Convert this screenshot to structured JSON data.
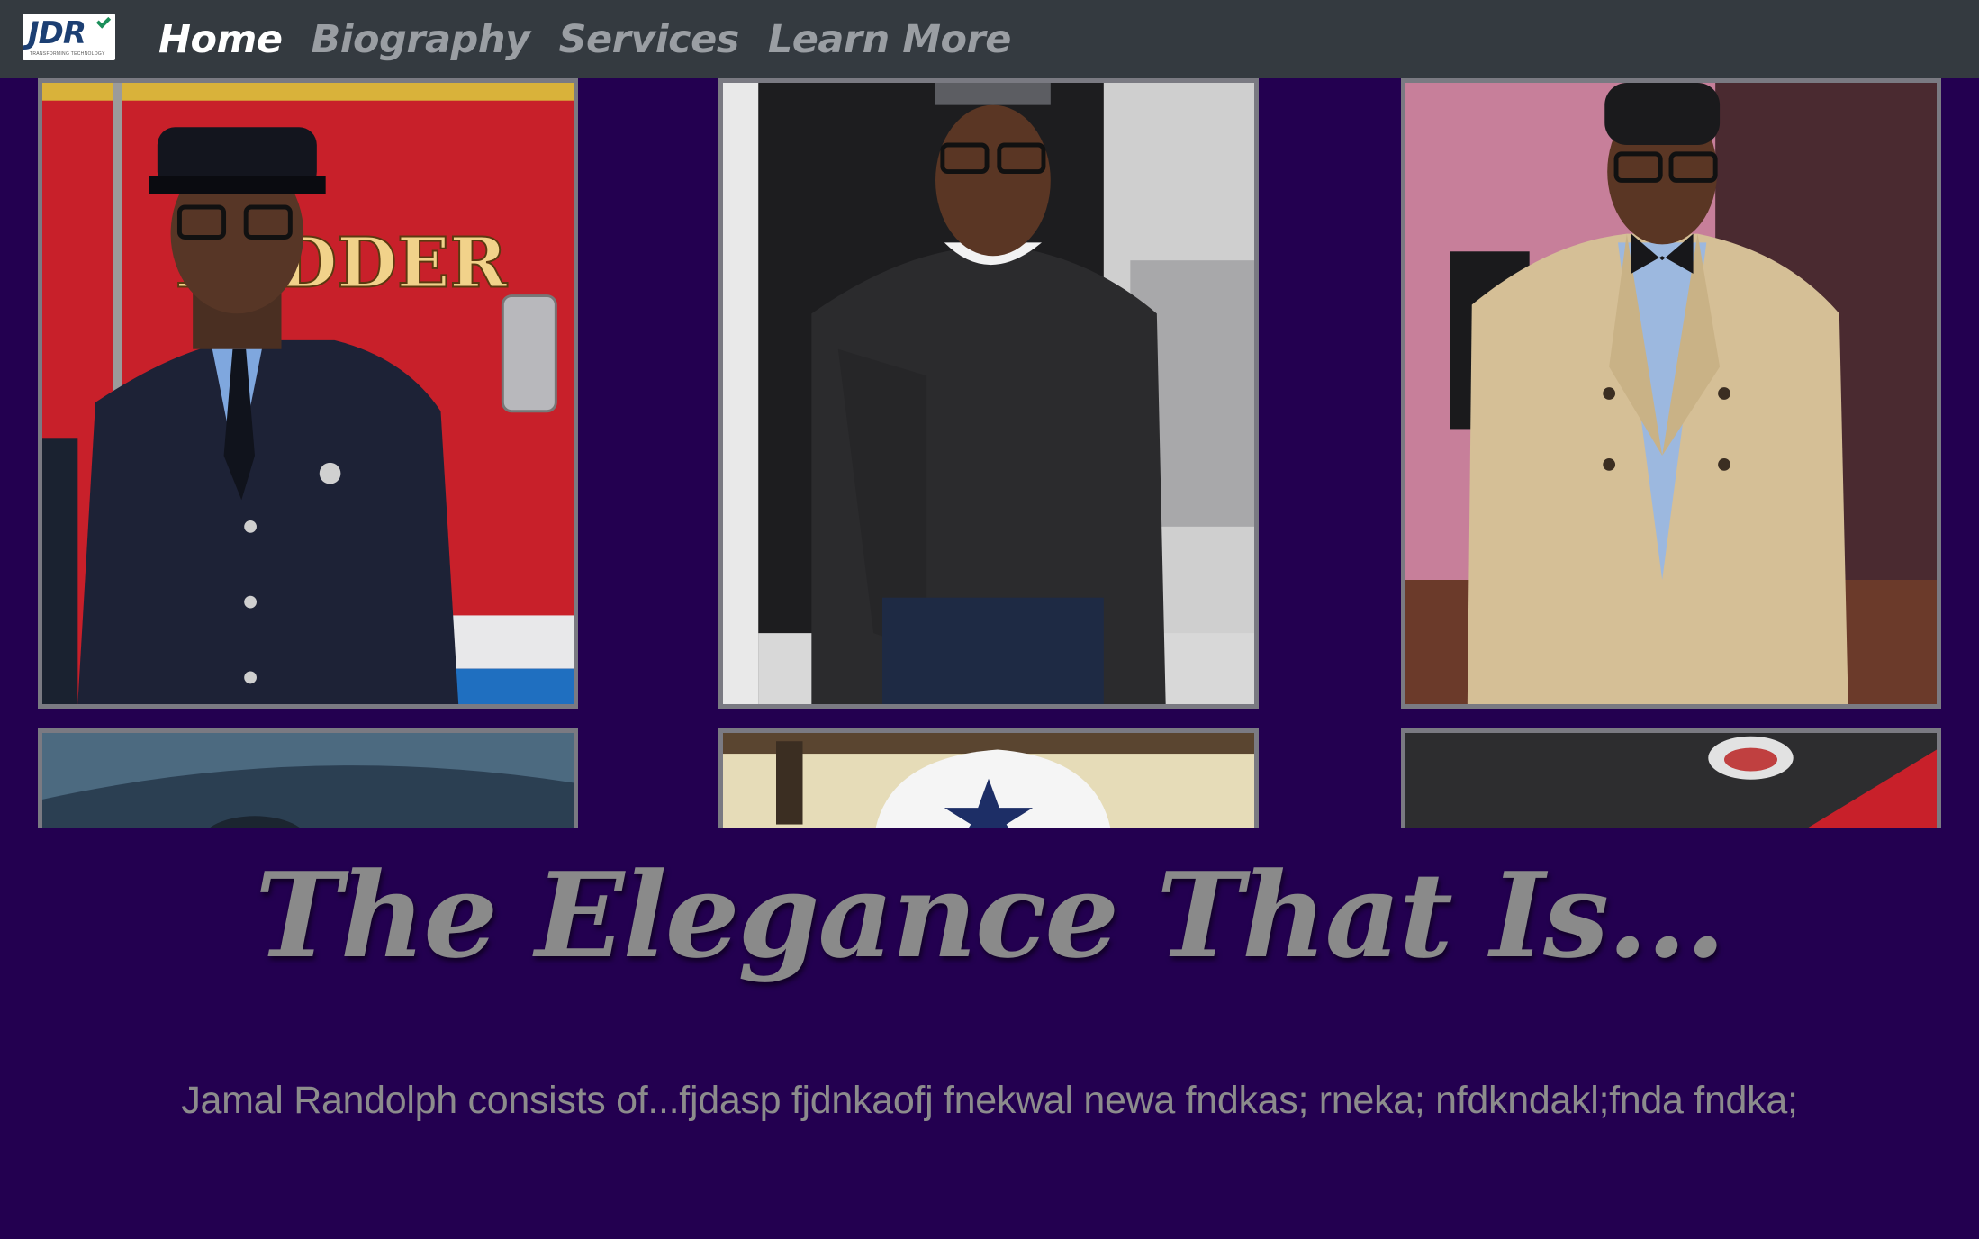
{
  "navbar": {
    "logo": {
      "text": "JDR",
      "subtext": "TRANSFORMING TECHNOLOGY"
    },
    "links": [
      {
        "label": "Home",
        "active": true
      },
      {
        "label": "Biography",
        "active": false
      },
      {
        "label": "Services",
        "active": false
      },
      {
        "label": "Learn More",
        "active": false
      }
    ]
  },
  "gallery": {
    "photos": [
      {
        "name": "photo-firefighter-uniform"
      },
      {
        "name": "photo-dark-sweater"
      },
      {
        "name": "photo-trench-coat-bowtie"
      },
      {
        "name": "photo-cap-blue"
      },
      {
        "name": "photo-cowboys-hat"
      },
      {
        "name": "photo-ceiling-light"
      }
    ]
  },
  "hero": {
    "title": "The Elegance That Is...",
    "body": "Jamal Randolph consists of...fjdasp fjdnkaofj fnekwal newa fndkas; rneka; nfdkndakl;fnda fndka;"
  },
  "colors": {
    "page_background": "#230050",
    "navbar_background": "#343a40",
    "nav_active": "#ffffff",
    "nav_inactive": "#9a9ea3",
    "hero_text": "#8a8a8a"
  }
}
